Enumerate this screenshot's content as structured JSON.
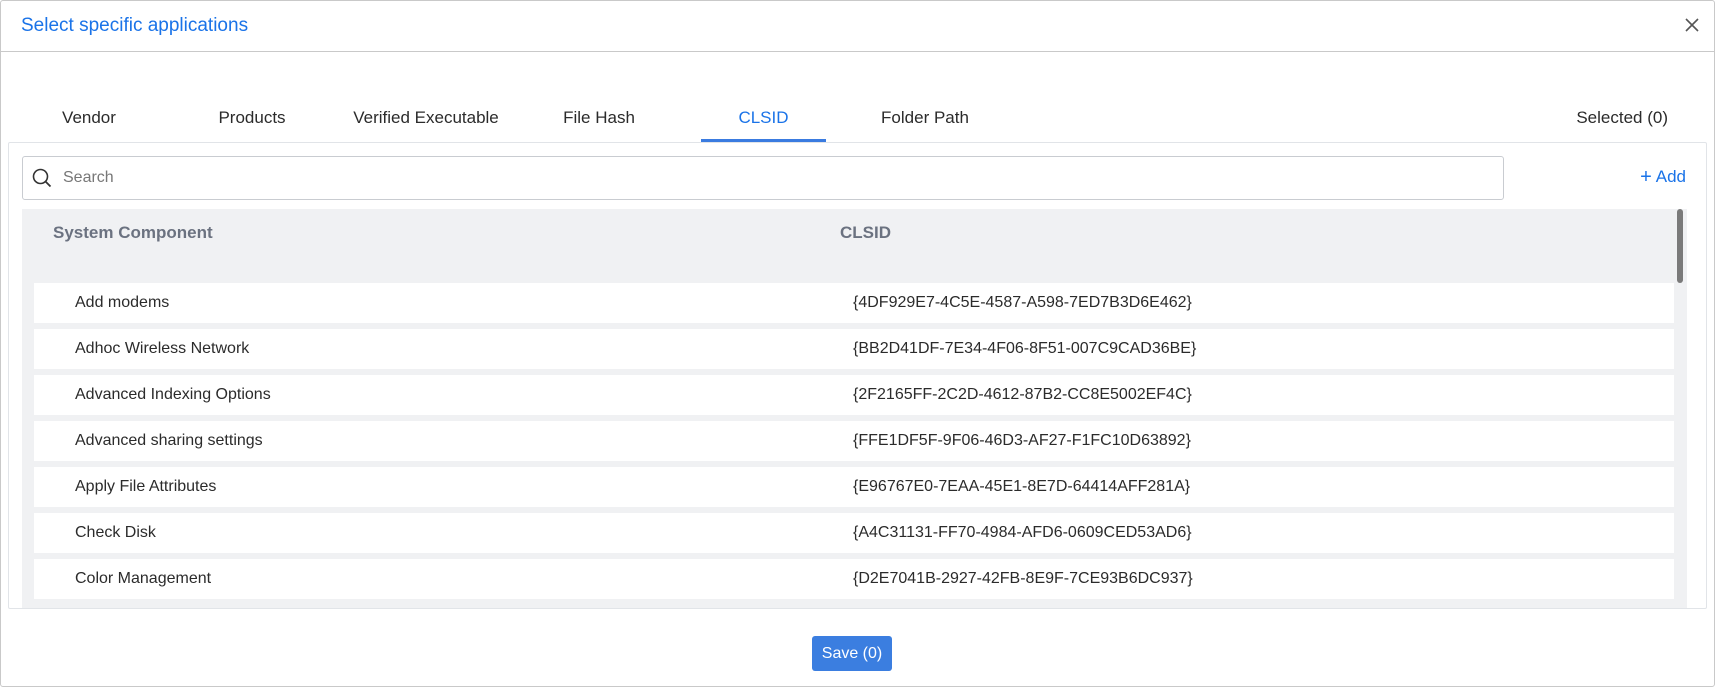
{
  "dialog": {
    "title": "Select specific applications",
    "close_icon": "close-icon"
  },
  "tabs": [
    {
      "label": "Vendor",
      "active": false
    },
    {
      "label": "Products",
      "active": false
    },
    {
      "label": "Verified Executable",
      "active": false
    },
    {
      "label": "File Hash",
      "active": false
    },
    {
      "label": "CLSID",
      "active": true
    },
    {
      "label": "Folder Path",
      "active": false
    }
  ],
  "selected_label": "Selected (0)",
  "search": {
    "placeholder": "Search",
    "value": ""
  },
  "add_label": "Add",
  "table": {
    "columns": [
      "System Component",
      "CLSID"
    ],
    "rows": [
      {
        "component": "Add modems",
        "clsid": "{4DF929E7-4C5E-4587-A598-7ED7B3D6E462}"
      },
      {
        "component": "Adhoc Wireless Network",
        "clsid": "{BB2D41DF-7E34-4F06-8F51-007C9CAD36BE}"
      },
      {
        "component": "Advanced Indexing Options",
        "clsid": "{2F2165FF-2C2D-4612-87B2-CC8E5002EF4C}"
      },
      {
        "component": "Advanced sharing settings",
        "clsid": "{FFE1DF5F-9F06-46D3-AF27-F1FC10D63892}"
      },
      {
        "component": "Apply File Attributes",
        "clsid": "{E96767E0-7EAA-45E1-8E7D-64414AFF281A}"
      },
      {
        "component": "Check Disk",
        "clsid": "{A4C31131-FF70-4984-AFD6-0609CED53AD6}"
      },
      {
        "component": "Color Management",
        "clsid": "{D2E7041B-2927-42FB-8E9F-7CE93B6DC937}"
      }
    ]
  },
  "save_label": "Save (0)",
  "colors": {
    "accent": "#1a73e8",
    "button": "#3b7ee0",
    "table_header_bg": "#f0f1f3"
  }
}
